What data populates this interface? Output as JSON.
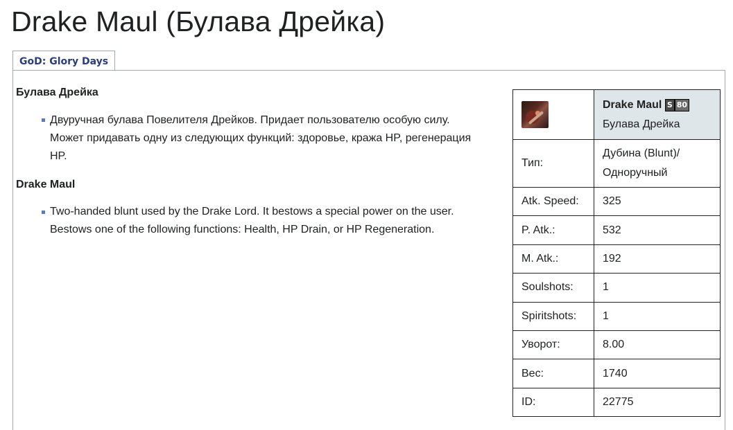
{
  "page": {
    "title": "Drake Maul (Булава Дрейка)",
    "tab_label": "GoD: Glory Days"
  },
  "description": {
    "ru": {
      "heading": "Булава Дрейка",
      "lines": [
        "Двуручная булава Повелителя Дрейков. Придает пользователю особую силу.",
        "Может придавать одну из следующих функций: здоровье, кража HP, регенерация",
        "HP."
      ]
    },
    "en": {
      "heading": "Drake Maul",
      "lines": [
        "Two-handed blunt used by the Drake Lord. It bestows a special power on the user.",
        "Bestows one of the following functions: Health, HP Drain, or HP Regeneration."
      ]
    }
  },
  "infobox": {
    "icon": "drake-maul-item-icon",
    "name_en": "Drake Maul",
    "grade": "S",
    "level": "80",
    "name_ru": "Булава Дрейка",
    "type_label": "Тип:",
    "type_value_line1": "Дубина (Blunt)/",
    "type_value_line2": "Одноручный",
    "rows": [
      {
        "label": "Atk. Speed:",
        "value": "325"
      },
      {
        "label": "P. Atk.:",
        "value": "532"
      },
      {
        "label": "M. Atk.:",
        "value": "192"
      },
      {
        "label": "Soulshots:",
        "value": "1"
      },
      {
        "label": "Spiritshots:",
        "value": "1"
      },
      {
        "label": "Уворот:",
        "value": "8.00"
      },
      {
        "label": "Вес:",
        "value": "1740"
      },
      {
        "label": "ID:",
        "value": "22775"
      }
    ]
  },
  "colors": {
    "tab_text": "#2a3d7d",
    "header_bg": "#dfe6e9",
    "bullet": "#5f79b5",
    "border": "#a2a9b1"
  }
}
